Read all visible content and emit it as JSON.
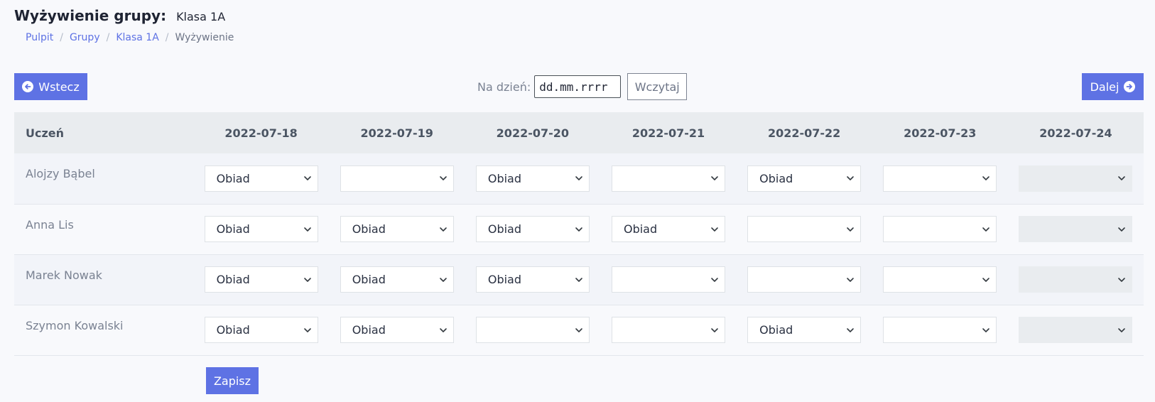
{
  "header": {
    "title": "Wyżywienie grupy:",
    "group_name": "Klasa 1A"
  },
  "breadcrumb": {
    "items": [
      "Pulpit",
      "Grupy",
      "Klasa 1A"
    ],
    "current": "Wyżywienie"
  },
  "toolbar": {
    "back_label": "Wstecz",
    "next_label": "Dalej",
    "date_label": "Na dzień:",
    "date_placeholder": "dd.mm.rrrr",
    "load_label": "Wczytaj"
  },
  "table": {
    "student_header": "Uczeń",
    "dates": [
      "2022-07-18",
      "2022-07-19",
      "2022-07-20",
      "2022-07-21",
      "2022-07-22",
      "2022-07-23",
      "2022-07-24"
    ],
    "rows": [
      {
        "name": "Alojzy Bąbel",
        "meals": [
          "Obiad",
          "",
          "Obiad",
          "",
          "Obiad",
          "",
          ""
        ]
      },
      {
        "name": "Anna Lis",
        "meals": [
          "Obiad",
          "Obiad",
          "Obiad",
          "Obiad",
          "",
          "",
          ""
        ]
      },
      {
        "name": "Marek Nowak",
        "meals": [
          "Obiad",
          "Obiad",
          "Obiad",
          "",
          "",
          "",
          ""
        ]
      },
      {
        "name": "Szymon Kowalski",
        "meals": [
          "Obiad",
          "Obiad",
          "",
          "",
          "Obiad",
          "",
          ""
        ]
      }
    ],
    "disabled_columns": [
      6
    ]
  },
  "footer": {
    "save_label": "Zapisz"
  },
  "colors": {
    "primary": "#5e72e4",
    "background": "#f8f9fc",
    "header_bg": "#e9ecef",
    "disabled_bg": "#e9ecef"
  },
  "icons": {
    "back": "arrow-circle-left-icon",
    "next": "arrow-circle-right-icon",
    "select": "chevron-down-icon"
  }
}
